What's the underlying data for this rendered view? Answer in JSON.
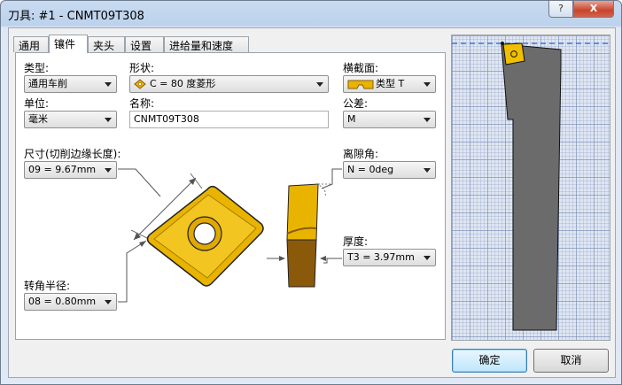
{
  "window": {
    "title": "刀具: #1 - CNMT09T308",
    "help_label": "?",
    "close_label": "X"
  },
  "tabs": [
    {
      "label": "通用",
      "active": false
    },
    {
      "label": "镶件",
      "active": true
    },
    {
      "label": "夹头",
      "active": false
    },
    {
      "label": "设置",
      "active": false
    },
    {
      "label": "进给量和速度",
      "active": false
    }
  ],
  "form": {
    "type_label": "类型:",
    "type_value": "通用车削",
    "shape_label": "形状:",
    "shape_value": "C = 80 度菱形",
    "cross_section_label": "横截面:",
    "cross_section_value": "类型 T",
    "unit_label": "单位:",
    "unit_value": "毫米",
    "name_label": "名称:",
    "name_value": "CNMT09T308",
    "tolerance_label": "公差:",
    "tolerance_value": "M",
    "size_label": "尺寸(切削边缘长度):",
    "size_value": "09 = 9.67mm",
    "clearance_label": "离隙角:",
    "clearance_value": "N = 0deg",
    "thickness_label": "厚度:",
    "thickness_value": "T3 = 3.97mm",
    "corner_radius_label": "转角半径:",
    "corner_radius_value": "08 = 0.80mm"
  },
  "buttons": {
    "ok_label": "确定",
    "cancel_label": "取消"
  },
  "colors": {
    "insert": "#e8b400",
    "insert_dark": "#8a5a0a",
    "holder": "#6b6b6b",
    "preview_bg": "#dfe6f2",
    "dashed_line": "#3a78d8"
  }
}
